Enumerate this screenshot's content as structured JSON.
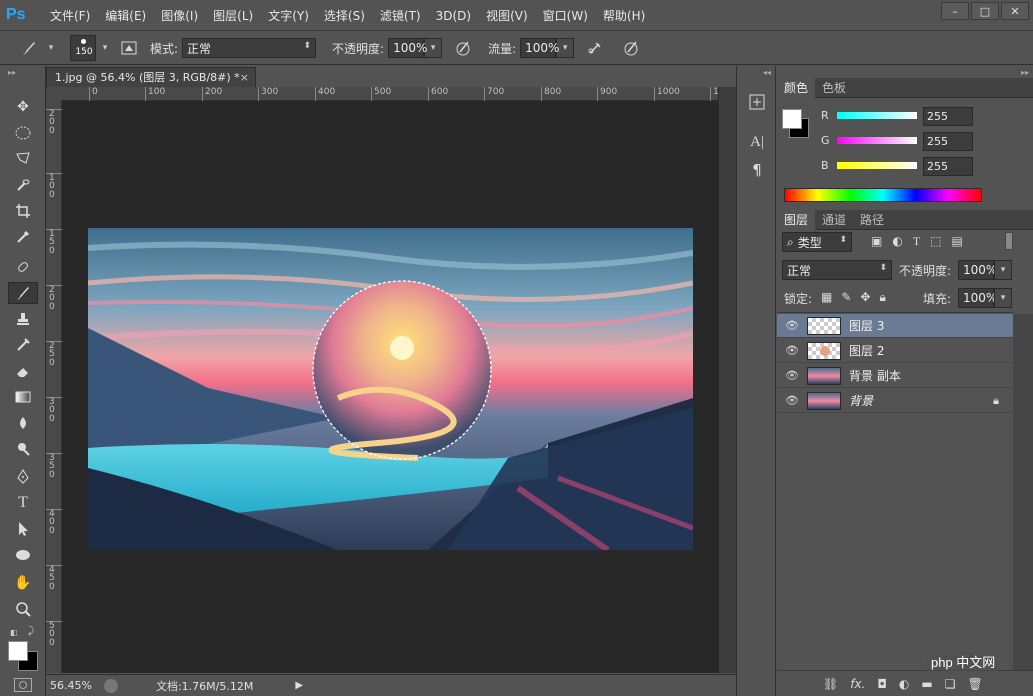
{
  "app": {
    "logo": "Ps"
  },
  "menu": [
    "文件(F)",
    "编辑(E)",
    "图像(I)",
    "图层(L)",
    "文字(Y)",
    "选择(S)",
    "滤镜(T)",
    "3D(D)",
    "视图(V)",
    "窗口(W)",
    "帮助(H)"
  ],
  "window_controls": {
    "minimize": "–",
    "maximize": "□",
    "close": "✕"
  },
  "options": {
    "brush_size": "150",
    "mode_label": "模式:",
    "mode_value": "正常",
    "opacity_label": "不透明度:",
    "opacity_value": "100%",
    "flow_label": "流量:",
    "flow_value": "100%"
  },
  "document": {
    "tab_title": "1.jpg @ 56.4% (图层 3, RGB/8#) *",
    "tab_close": "×",
    "ruler_top": [
      "0",
      "100",
      "200",
      "300",
      "400",
      "500",
      "600",
      "700",
      "800",
      "900",
      "1000",
      "1"
    ],
    "ruler_left": [
      "2",
      "0",
      "0",
      "1",
      "0",
      "0",
      "1",
      "5",
      "0",
      "2",
      "0",
      "0",
      "2",
      "5",
      "0",
      "3",
      "0",
      "0",
      "3",
      "5",
      "0",
      "4",
      "0",
      "0",
      "4",
      "5",
      "0",
      "5",
      "0",
      "0",
      "5",
      "5",
      "0",
      "6",
      "0",
      "0",
      "6",
      "5",
      "0",
      "7",
      "0",
      "0"
    ]
  },
  "status": {
    "zoom": "56.45%",
    "doc_info": "文档:1.76M/5.12M"
  },
  "color_panel": {
    "tabs": [
      "颜色",
      "色板"
    ],
    "r_label": "R",
    "g_label": "G",
    "b_label": "B",
    "r": "255",
    "g": "255",
    "b": "255"
  },
  "layers_panel": {
    "tabs": [
      "图层",
      "通道",
      "路径"
    ],
    "filter_label": "类型",
    "blend_mode": "正常",
    "opacity_label": "不透明度:",
    "opacity_value": "100%",
    "lock_label": "锁定:",
    "fill_label": "填充:",
    "fill_value": "100%",
    "layers": [
      {
        "name": "图层 3",
        "selected": true
      },
      {
        "name": "图层 2",
        "selected": false
      },
      {
        "name": "背景 副本",
        "selected": false
      },
      {
        "name": "背景",
        "selected": false,
        "locked": true
      }
    ]
  },
  "watermark": "php 中文网",
  "colors": {
    "accent": "#26a9ff",
    "selected_layer": "#6a7a93",
    "canvas_bg": "#282828"
  }
}
